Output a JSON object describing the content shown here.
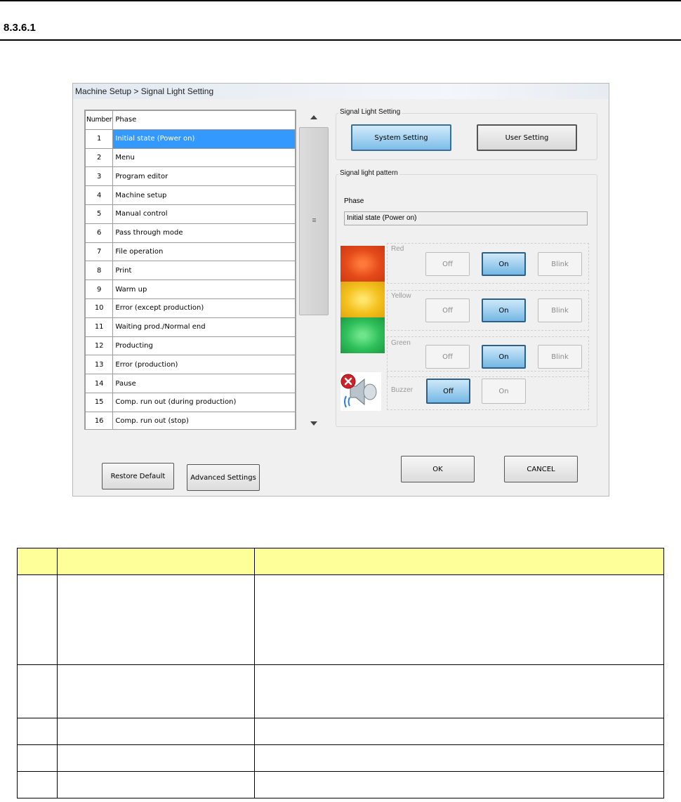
{
  "section_number": "8.3.6.1",
  "dialog": {
    "title": "Machine Setup > Signal Light Setting",
    "table": {
      "columns": [
        "Number",
        "Phase"
      ],
      "rows": [
        {
          "num": "1",
          "phase": "Initial state (Power on)"
        },
        {
          "num": "2",
          "phase": "Menu"
        },
        {
          "num": "3",
          "phase": "Program editor"
        },
        {
          "num": "4",
          "phase": "Machine setup"
        },
        {
          "num": "5",
          "phase": "Manual control"
        },
        {
          "num": "6",
          "phase": "Pass through mode"
        },
        {
          "num": "7",
          "phase": "File operation"
        },
        {
          "num": "8",
          "phase": "Print"
        },
        {
          "num": "9",
          "phase": "Warm up"
        },
        {
          "num": "10",
          "phase": "Error (except production)"
        },
        {
          "num": "11",
          "phase": "Waiting prod./Normal end"
        },
        {
          "num": "12",
          "phase": "Producting"
        },
        {
          "num": "13",
          "phase": "Error (production)"
        },
        {
          "num": "14",
          "phase": "Pause"
        },
        {
          "num": "15",
          "phase": "Comp. run out (during production)"
        },
        {
          "num": "16",
          "phase": "Comp. run out (stop)"
        }
      ],
      "selected_index": 0
    },
    "signal_light_setting": {
      "label": "Signal Light Setting",
      "system_button": "System Setting",
      "user_button": "User Setting"
    },
    "pattern": {
      "label": "Signal light pattern",
      "phase_caption": "Phase",
      "phase_value": "Initial state (Power on)",
      "lights": [
        {
          "label": "Red",
          "off": "Off",
          "on": "On",
          "blink": "Blink",
          "state": "On"
        },
        {
          "label": "Yellow",
          "off": "Off",
          "on": "On",
          "blink": "Blink",
          "state": "On"
        },
        {
          "label": "Green",
          "off": "Off",
          "on": "On",
          "blink": "Blink",
          "state": "On"
        }
      ],
      "buzzer": {
        "label": "Buzzer",
        "off": "Off",
        "on": "On",
        "state": "Off"
      }
    },
    "buttons": {
      "restore_default": "Restore Default",
      "advanced_settings": "Advanced Settings",
      "ok": "OK",
      "cancel": "CANCEL"
    },
    "colors": {
      "selection": "#3399ff",
      "red_lamp": "#e44a1a",
      "yellow_lamp": "#f3c01d",
      "green_lamp": "#2fbf5a"
    }
  },
  "spec_table": {
    "header_color": "#ffff99",
    "rows": 5
  }
}
